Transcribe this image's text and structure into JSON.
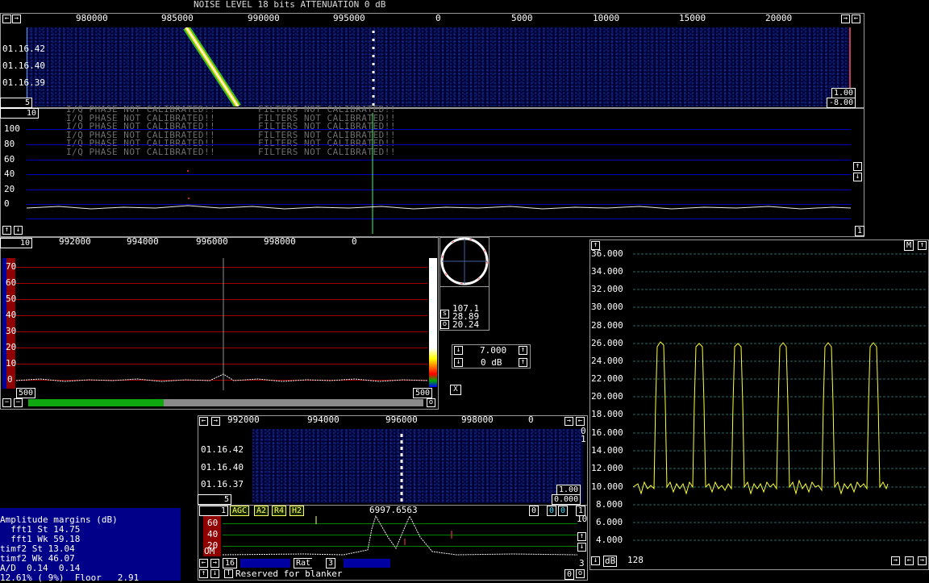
{
  "status_line": "NOISE LEVEL 18 bits ATTENUATION 0 dB",
  "main_wf": {
    "freq_ticks": [
      "980000",
      "985000",
      "990000",
      "995000",
      "0",
      "5000",
      "10000",
      "15000",
      "20000"
    ],
    "times": [
      "01.16.42",
      "01.16.40",
      "01.16.39"
    ],
    "avg_label": "5",
    "gain_top": "1.00",
    "gain_bottom": "-8.00"
  },
  "main_spec": {
    "avg_label": "10",
    "warning_iq": "I/Q PHASE NOT CALIBRATED!!",
    "warning_filters": "FILTERS NOT CALIBRATED!!",
    "y_ticks": [
      "100",
      "80",
      "60",
      "40",
      "20",
      "0"
    ],
    "corner_value": "1"
  },
  "hires": {
    "avg_label": "10",
    "freq_ticks": [
      "992000",
      "994000",
      "996000",
      "998000",
      "0"
    ],
    "y_ticks": [
      "70",
      "60",
      "50",
      "40",
      "30",
      "20",
      "10",
      "0"
    ],
    "left_value": "500",
    "right_value": "500"
  },
  "polar": {
    "s_label": "s",
    "o_label": "o",
    "values": [
      "107.1",
      "28.89",
      "20.24"
    ]
  },
  "agc_ctrl": {
    "value1": "7.000",
    "value2": "0 dB"
  },
  "close_x": "X",
  "baseband": {
    "freq_ticks": [
      "992000",
      "994000",
      "996000",
      "998000",
      "0"
    ],
    "times": [
      "01.16.42",
      "01.16.40",
      "01.16.37"
    ],
    "right_numbers": [
      "0",
      "1"
    ],
    "gain_top": "1.00",
    "gain_bottom": "0.000",
    "avg_label": "5",
    "freq_readout": "6997.6563",
    "tags": [
      "AGC",
      "A2",
      "R4",
      "H2"
    ],
    "num_boxes_left": [
      "1"
    ],
    "num_boxes_right": [
      "0",
      "0",
      "0",
      "1"
    ],
    "y_ticks": [
      "60",
      "40",
      "20"
    ],
    "side_value": "10",
    "om_label": "OM",
    "bottom_left_num": "16",
    "rat_label": "Rat",
    "rat_value": "3",
    "right_num": "3",
    "blanker_text": "Reserved for blanker",
    "bottom_right_box": "0"
  },
  "amplitude": {
    "title": "Amplitude margins (dB)",
    "rows": [
      {
        "label": "  fft1 St",
        "value": "14.75"
      },
      {
        "label": "  fft1 Wk",
        "value": "59.18"
      },
      {
        "label": "timf2 St",
        "value": "13.04"
      },
      {
        "label": "timf2 Wk",
        "value": "46.07"
      }
    ],
    "ad_line": "A/D  0.14  0.14",
    "pct_line": "12.61% ( 9%)  Floor   2.91"
  },
  "meter": {
    "y_ticks": [
      "36.000",
      "34.000",
      "32.000",
      "30.000",
      "28.000",
      "26.000",
      "24.000",
      "22.000",
      "20.000",
      "18.000",
      "16.000",
      "14.000",
      "12.000",
      "10.000",
      "8.000",
      "6.000",
      "4.000"
    ],
    "m_label": "M",
    "db_label": "dB",
    "value": "128"
  },
  "colors": {
    "blue_grid": "#0000c0",
    "red_grid": "#a00000",
    "green_grid": "#008000",
    "trace_yellow": "#ffff40",
    "cyan_marker": "#00c8ff"
  }
}
